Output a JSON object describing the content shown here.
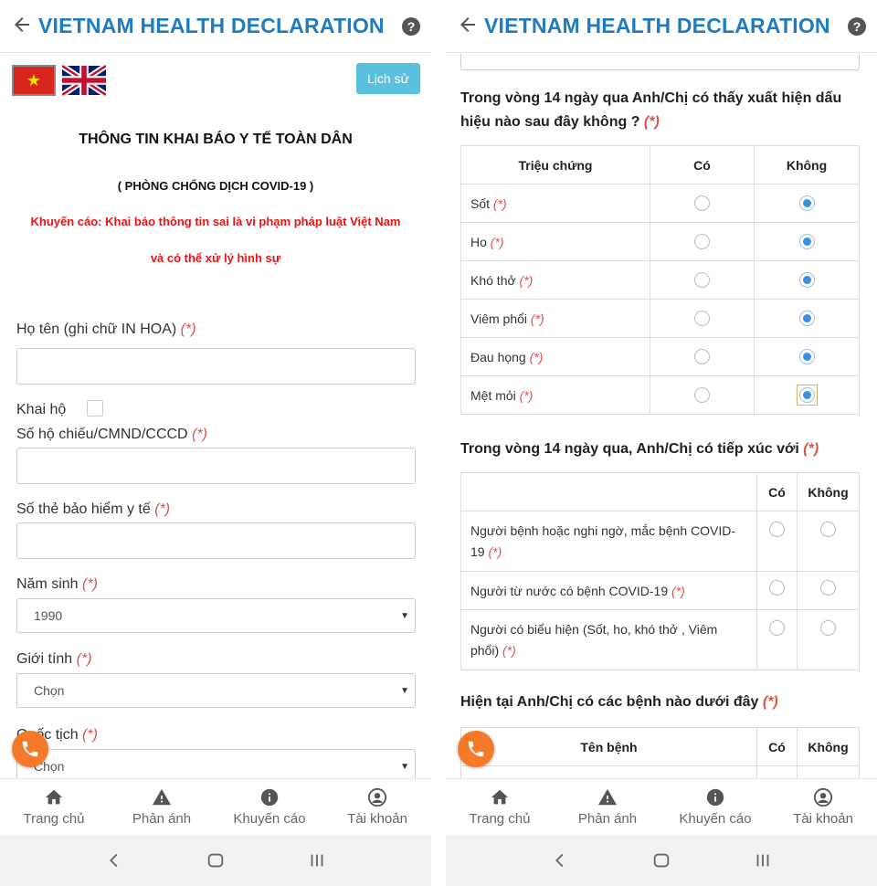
{
  "app": {
    "title": "VIETNAM HEALTH DECLARATION",
    "help_icon": "?"
  },
  "left": {
    "history_button": "Lịch sử",
    "heading": "THÔNG TIN KHAI BÁO Y TẾ TOÀN DÂN",
    "subheading": "( PHÒNG CHỐNG DỊCH COVID-19 )",
    "warning_line1": "Khuyến cáo: Khai báo thông tin sai là vi phạm pháp luật Việt Nam",
    "warning_line2": "và có thể xử lý hình sự",
    "required_mark": "(*)",
    "fields": {
      "full_name_label": "Họ tên (ghi chữ IN HOA)",
      "on_behalf_label": "Khai hộ",
      "passport_label": "Số hộ chiếu/CMND/CCCD",
      "insurance_label": "Số thẻ bảo hiểm y tế",
      "birth_year_label": "Năm sinh",
      "birth_year_value": "1990",
      "gender_label": "Giới tính",
      "gender_value": "Chọn",
      "nationality_label": "Quốc tịch",
      "nationality_value": "Chọn"
    }
  },
  "right": {
    "q1": "Trong vòng 14 ngày qua Anh/Chị có thấy xuất hiện dấu hiệu nào sau đây không ?",
    "symptoms_table": {
      "headers": [
        "Triệu chứng",
        "Có",
        "Không"
      ],
      "rows": [
        {
          "name": "Sốt",
          "answer": "Không"
        },
        {
          "name": "Ho",
          "answer": "Không"
        },
        {
          "name": "Khó thở",
          "answer": "Không"
        },
        {
          "name": "Viêm phổi",
          "answer": "Không"
        },
        {
          "name": "Đau họng",
          "answer": "Không"
        },
        {
          "name": "Mệt mỏi",
          "answer": "Không"
        }
      ]
    },
    "q2": "Trong vòng 14 ngày qua, Anh/Chị có tiếp xúc với",
    "contact_table": {
      "headers": [
        "",
        "Có",
        "Không"
      ],
      "rows": [
        "Người bệnh hoặc nghi ngờ, mắc bệnh COVID-19",
        "Người từ nước có bệnh COVID-19",
        "Người có biểu hiện (Sốt, ho, khó thở , Viêm phổi)"
      ]
    },
    "q3": "Hiện tại Anh/Chị có các bệnh nào dưới đây",
    "disease_table": {
      "headers": [
        "Tên bệnh",
        "Có",
        "Không"
      ]
    }
  },
  "nav": {
    "items": [
      "Trang chủ",
      "Phản ánh",
      "Khuyến cáo",
      "Tài khoản"
    ]
  },
  "colors": {
    "brand_blue": "#1f7cc1",
    "warning_red": "#e11111",
    "history_button": "#5bc0de",
    "call_button": "#f47a2a"
  }
}
